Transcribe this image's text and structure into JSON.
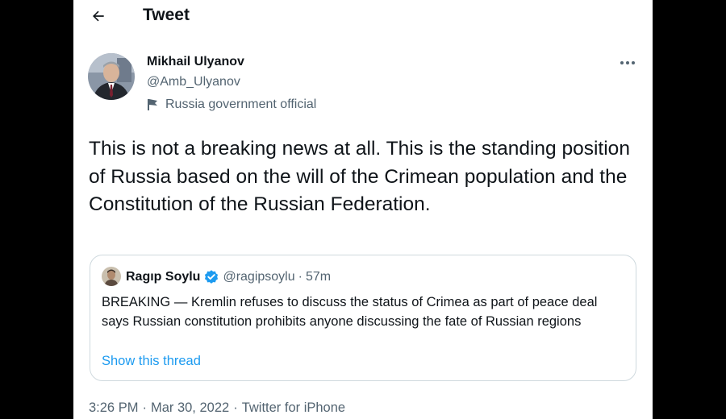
{
  "header": {
    "title": "Tweet",
    "back_icon": "arrow-left-icon"
  },
  "tweet": {
    "author": {
      "name": "Mikhail Ulyanov",
      "handle": "@Amb_Ulyanov",
      "affiliation": "Russia government official",
      "affiliation_icon": "flag-icon"
    },
    "more_icon": "more-dots-icon",
    "text": "This is not a breaking news at all. This is the standing position of Russia based on the will of the Crimean population and the Constitution of the Russian Federation.",
    "quoted": {
      "name": "Ragıp Soylu",
      "verified_icon": "verified-badge-icon",
      "handle": "@ragipsoylu",
      "separator": "·",
      "time": "57m",
      "text": "BREAKING  — Kremlin refuses to discuss the status of Crimea as part of peace deal says Russian constitution prohibits anyone discussing the fate of Russian regions",
      "show_thread": "Show this thread"
    },
    "time": "3:26 PM",
    "date": "Mar 30, 2022",
    "source": "Twitter for iPhone",
    "separator": "·"
  },
  "colors": {
    "background": "#000000",
    "card": "#ffffff",
    "text_primary": "#0f1419",
    "text_secondary": "#536471",
    "link": "#1d9bf0",
    "border": "#cfd9de"
  }
}
